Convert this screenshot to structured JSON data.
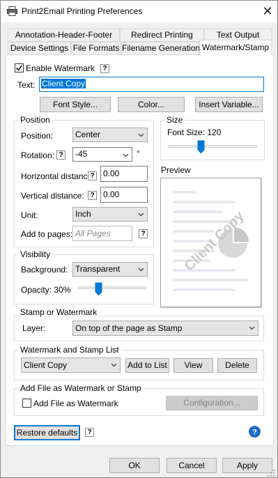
{
  "window": {
    "title": "Print2Email Printing Preferences",
    "close_glyph": "✕"
  },
  "tabs_row1": [
    "Annotation-Header-Footer",
    "Redirect Printing",
    "Text Output"
  ],
  "tabs_row2": [
    "Device Settings",
    "File Formats",
    "Filename Generation",
    "Watermark/Stamp"
  ],
  "watermark": {
    "enable_label": "Enable Watermark",
    "enable_checked": true,
    "text_label": "Text:",
    "text_value": "Client Copy",
    "font_style_button": "Font Style...",
    "color_button": "Color...",
    "insert_variable_button": "Insert Variable..."
  },
  "position": {
    "group_label": "Position",
    "position_label": "Position:",
    "position_value": "Center",
    "rotation_label": "Rotation:",
    "rotation_value": "-45",
    "rotation_unit": "°",
    "hdist_label": "Horizontal distance:",
    "hdist_value": "0.00",
    "vdist_label": "Vertical distance:",
    "vdist_value": "0.00",
    "unit_label": "Unit:",
    "unit_value": "Inch",
    "pages_label": "Add to pages:",
    "pages_placeholder": "All Pages"
  },
  "size": {
    "group_label": "Size",
    "font_size_label": "Font Size: 120",
    "slider_fraction": 0.37
  },
  "preview": {
    "label": "Preview",
    "watermark_text": "Client Copy"
  },
  "visibility": {
    "group_label": "Visibility",
    "background_label": "Background:",
    "background_value": "Transparent",
    "opacity_label": "Opacity: 30%",
    "opacity_fraction": 0.3
  },
  "stamp": {
    "group_label": "Stamp or Watermark",
    "layer_label": "Layer:",
    "layer_value": "On top of the page as Stamp"
  },
  "list": {
    "group_label": "Watermark and Stamp List",
    "selected": "Client Copy",
    "add_button": "Add to List",
    "view_button": "View",
    "delete_button": "Delete"
  },
  "addfile": {
    "group_label": "Add File as Watermark or Stamp",
    "checkbox_label": "Add File as Watermark",
    "checked": false,
    "config_button": "Configuration..."
  },
  "footer": {
    "restore_button": "Restore defaults",
    "ok_button": "OK",
    "cancel_button": "Cancel",
    "apply_button": "Apply",
    "help_glyph": "?"
  },
  "colors": {
    "accent": "#0078d7",
    "selection": "#0078d7",
    "slider_thumb": "#0078d7"
  }
}
